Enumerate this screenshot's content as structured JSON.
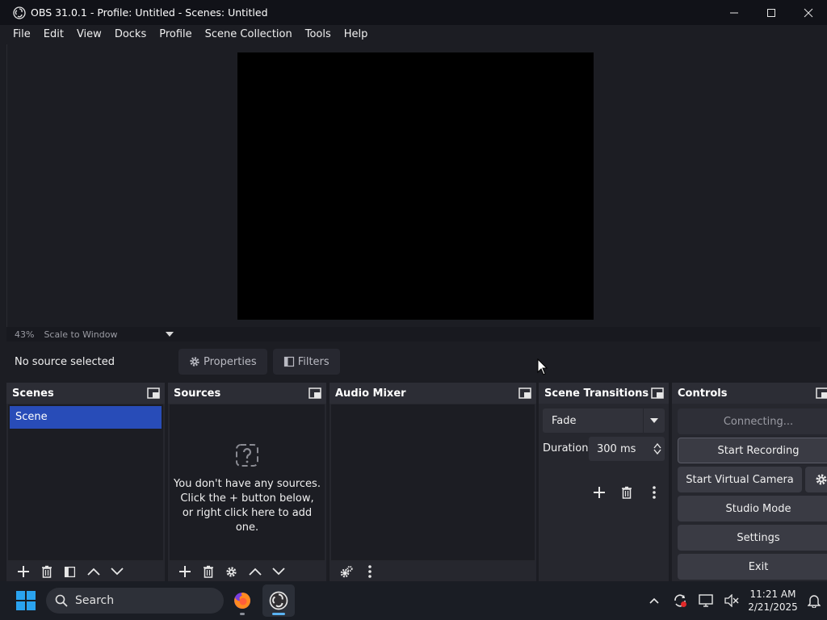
{
  "window": {
    "title": "OBS 31.0.1 - Profile: Untitled - Scenes: Untitled",
    "minimize_icon": "minimize-icon",
    "maximize_icon": "maximize-icon",
    "close_icon": "close-icon"
  },
  "menu": {
    "items": [
      "File",
      "Edit",
      "View",
      "Docks",
      "Profile",
      "Scene Collection",
      "Tools",
      "Help"
    ]
  },
  "preview": {
    "zoom": "43%",
    "scale_mode": "Scale to Window"
  },
  "source_toolbar": {
    "status": "No source selected",
    "properties_label": "Properties",
    "filters_label": "Filters"
  },
  "docks": {
    "scenes": {
      "title": "Scenes",
      "items": [
        "Scene"
      ]
    },
    "sources": {
      "title": "Sources",
      "empty_lines": [
        "You don't have any sources.",
        "Click the + button below,",
        "or right click here to add one."
      ]
    },
    "audio_mixer": {
      "title": "Audio Mixer"
    },
    "scene_transitions": {
      "title": "Scene Transitions",
      "transition": "Fade",
      "duration_label": "Duration",
      "duration_value": "300 ms"
    },
    "controls": {
      "title": "Controls",
      "buttons": [
        "Connecting...",
        "Start Recording",
        "Start Virtual Camera",
        "Studio Mode",
        "Settings",
        "Exit"
      ]
    }
  },
  "taskbar": {
    "search_placeholder": "Search",
    "time": "11:21 AM",
    "date": "2/21/2025"
  },
  "colors": {
    "accent": "#284cb8",
    "background": "#1c1d23",
    "dock": "#26272e",
    "button": "#3a3b44"
  }
}
